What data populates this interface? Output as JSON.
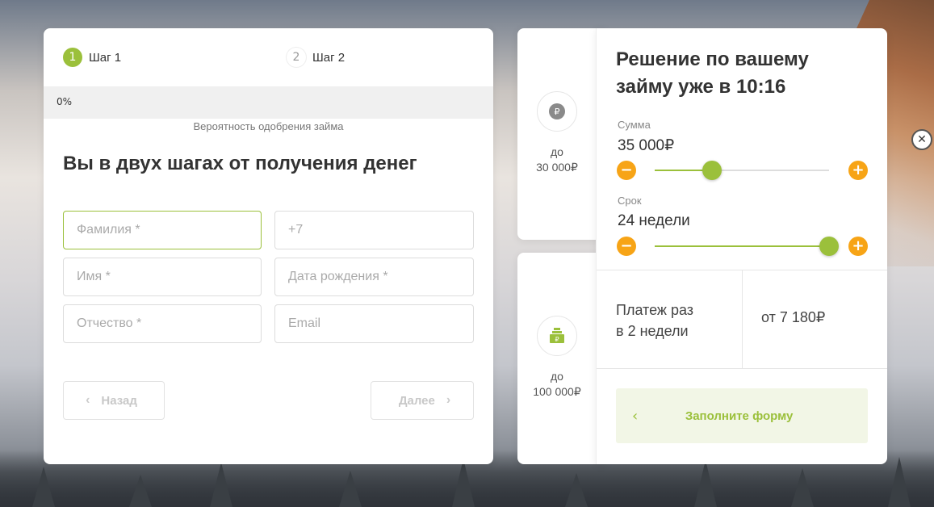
{
  "steps": [
    {
      "num": "1",
      "label": "Шаг 1"
    },
    {
      "num": "2",
      "label": "Шаг 2"
    }
  ],
  "progress": {
    "percent_label": "0%",
    "value": 0
  },
  "approval_text": "Вероятность одобрения займа",
  "form": {
    "title": "Вы в двух шагах от получения денег",
    "fields": {
      "surname": {
        "placeholder": "Фамилия *",
        "value": ""
      },
      "phone": {
        "placeholder": "+7",
        "value": ""
      },
      "name": {
        "placeholder": "Имя *",
        "value": ""
      },
      "birthdate": {
        "placeholder": "Дата рождения *",
        "value": ""
      },
      "patronymic": {
        "placeholder": "Отчество *",
        "value": ""
      },
      "email": {
        "placeholder": "Email",
        "value": ""
      }
    },
    "back_label": "Назад",
    "next_label": "Далее"
  },
  "offers": [
    {
      "icon": "ruble-coin-icon",
      "prefix": "до",
      "amount": "30 000₽"
    },
    {
      "icon": "money-stack-icon",
      "prefix": "до",
      "amount": "100 000₽"
    }
  ],
  "calculator": {
    "title": "Решение по вашему займу уже в 10:16",
    "amount_label": "Сумма",
    "amount_value": "35 000₽",
    "amount_slider_fraction": 0.33,
    "term_label": "Срок",
    "term_value": "24 недели",
    "term_slider_fraction": 1.0,
    "payment_label_line1": "Платеж раз",
    "payment_label_line2": "в 2 недели",
    "payment_value": "от 7 180₽",
    "submit_label": "Заполните форму"
  },
  "colors": {
    "accent_green": "#9bc03b",
    "accent_orange": "#f7a416"
  }
}
